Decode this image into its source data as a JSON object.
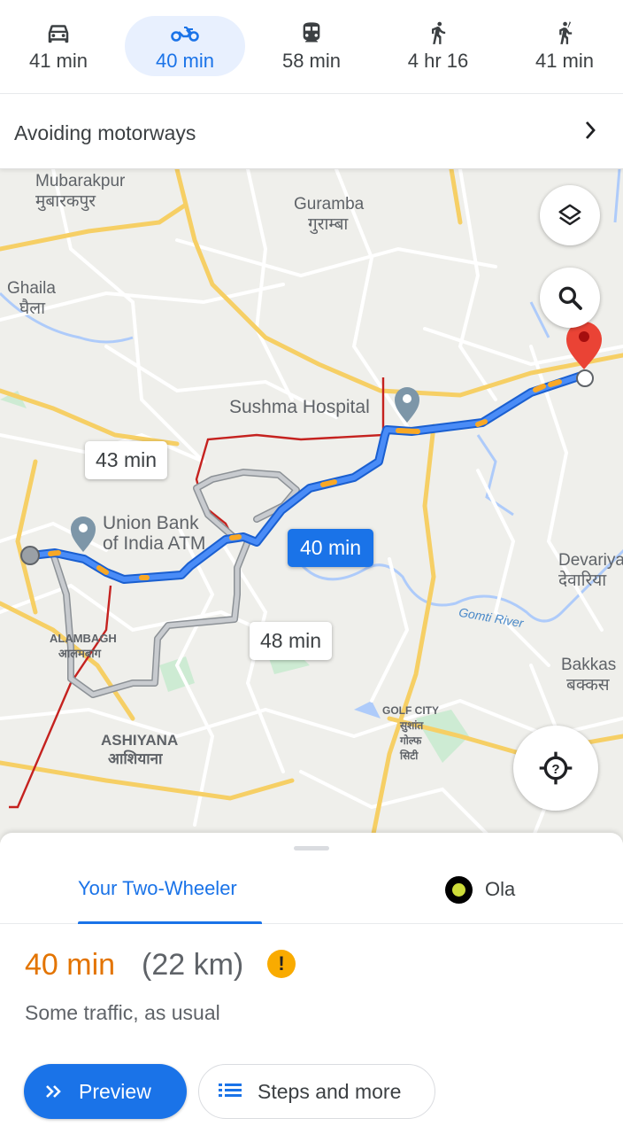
{
  "modes": [
    {
      "icon": "car-icon",
      "label": "41 min"
    },
    {
      "icon": "motorbike-icon",
      "label": "40 min"
    },
    {
      "icon": "train-icon",
      "label": "58 min"
    },
    {
      "icon": "walk-icon",
      "label": "4 hr 16"
    },
    {
      "icon": "ride-hail-icon",
      "label": "41 min"
    }
  ],
  "active_mode": "motorbike-icon",
  "avoid": {
    "text": "Avoiding motorways"
  },
  "map": {
    "places": {
      "mubarakpur_en": "Mubarakpur",
      "mubarakpur_hi": "मुबारकपुर",
      "guramba_en": "Guramba",
      "guramba_hi": "गुराम्बा",
      "ghaila_en": "Ghaila",
      "ghaila_hi": "घैला",
      "sushma": "Sushma Hospital",
      "unionbank_1": "Union Bank",
      "unionbank_2": "of India ATM",
      "devariya_en": "Devariya",
      "devariya_hi": "देवारिया",
      "bakkas_en": "Bakkas",
      "bakkas_hi": "बक्कस",
      "alambagh_en": "ALAMBAGH",
      "alambagh_hi": "आलमबाग",
      "ashiyana_en": "ASHIYANA",
      "ashiyana_hi": "आशियाना",
      "golfcity_en": "GOLF CITY",
      "golfcity_hi1": "सुशांत",
      "golfcity_hi2": "गोल्फ",
      "golfcity_hi3": "सिटी",
      "river": "Gomti River"
    },
    "route_labels": {
      "main": "40 min",
      "alt1": "43 min",
      "alt2": "48 min"
    },
    "colors": {
      "route": "#4285f4",
      "route_outline": "#1a5fd0",
      "traffic_slow": "#f9a825",
      "alt_route": "#9aa0a6",
      "rail": "#c5221f",
      "destination": "#ea4335"
    }
  },
  "sheet": {
    "tab_two_wheeler": "Your Two-Wheeler",
    "tab_ola": "Ola",
    "duration": "40 min",
    "distance": "(22 km)",
    "warning_glyph": "!",
    "traffic_note": "Some traffic, as usual",
    "preview_label": "Preview",
    "steps_label": "Steps and more"
  }
}
